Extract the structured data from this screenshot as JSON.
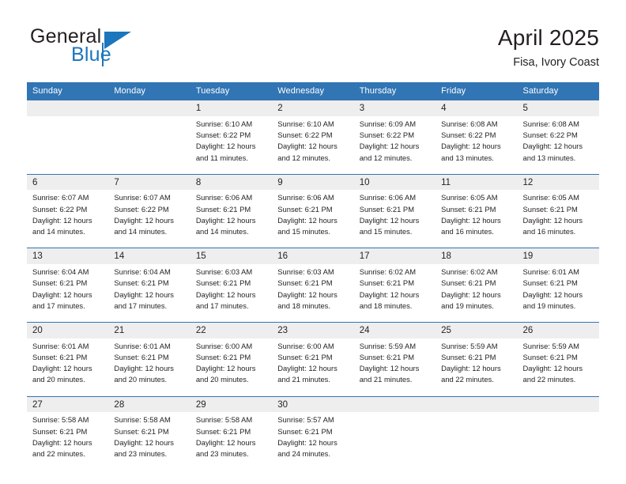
{
  "brand": {
    "name_part1": "General",
    "name_part2": "Blue",
    "logo_icon": "triangle-flag-icon"
  },
  "header": {
    "title": "April 2025",
    "subtitle": "Fisa, Ivory Coast"
  },
  "colors": {
    "header_blue": "#3175b4",
    "brand_blue": "#1c76bc",
    "daynum_band": "#eeeeee",
    "text": "#231f20"
  },
  "calendar": {
    "weekday_headers": [
      "Sunday",
      "Monday",
      "Tuesday",
      "Wednesday",
      "Thursday",
      "Friday",
      "Saturday"
    ],
    "weeks": [
      [
        {
          "day": "",
          "sunrise": "",
          "sunset": "",
          "daylight_line1": "",
          "daylight_line2": ""
        },
        {
          "day": "",
          "sunrise": "",
          "sunset": "",
          "daylight_line1": "",
          "daylight_line2": ""
        },
        {
          "day": "1",
          "sunrise": "Sunrise: 6:10 AM",
          "sunset": "Sunset: 6:22 PM",
          "daylight_line1": "Daylight: 12 hours",
          "daylight_line2": "and 11 minutes."
        },
        {
          "day": "2",
          "sunrise": "Sunrise: 6:10 AM",
          "sunset": "Sunset: 6:22 PM",
          "daylight_line1": "Daylight: 12 hours",
          "daylight_line2": "and 12 minutes."
        },
        {
          "day": "3",
          "sunrise": "Sunrise: 6:09 AM",
          "sunset": "Sunset: 6:22 PM",
          "daylight_line1": "Daylight: 12 hours",
          "daylight_line2": "and 12 minutes."
        },
        {
          "day": "4",
          "sunrise": "Sunrise: 6:08 AM",
          "sunset": "Sunset: 6:22 PM",
          "daylight_line1": "Daylight: 12 hours",
          "daylight_line2": "and 13 minutes."
        },
        {
          "day": "5",
          "sunrise": "Sunrise: 6:08 AM",
          "sunset": "Sunset: 6:22 PM",
          "daylight_line1": "Daylight: 12 hours",
          "daylight_line2": "and 13 minutes."
        }
      ],
      [
        {
          "day": "6",
          "sunrise": "Sunrise: 6:07 AM",
          "sunset": "Sunset: 6:22 PM",
          "daylight_line1": "Daylight: 12 hours",
          "daylight_line2": "and 14 minutes."
        },
        {
          "day": "7",
          "sunrise": "Sunrise: 6:07 AM",
          "sunset": "Sunset: 6:22 PM",
          "daylight_line1": "Daylight: 12 hours",
          "daylight_line2": "and 14 minutes."
        },
        {
          "day": "8",
          "sunrise": "Sunrise: 6:06 AM",
          "sunset": "Sunset: 6:21 PM",
          "daylight_line1": "Daylight: 12 hours",
          "daylight_line2": "and 14 minutes."
        },
        {
          "day": "9",
          "sunrise": "Sunrise: 6:06 AM",
          "sunset": "Sunset: 6:21 PM",
          "daylight_line1": "Daylight: 12 hours",
          "daylight_line2": "and 15 minutes."
        },
        {
          "day": "10",
          "sunrise": "Sunrise: 6:06 AM",
          "sunset": "Sunset: 6:21 PM",
          "daylight_line1": "Daylight: 12 hours",
          "daylight_line2": "and 15 minutes."
        },
        {
          "day": "11",
          "sunrise": "Sunrise: 6:05 AM",
          "sunset": "Sunset: 6:21 PM",
          "daylight_line1": "Daylight: 12 hours",
          "daylight_line2": "and 16 minutes."
        },
        {
          "day": "12",
          "sunrise": "Sunrise: 6:05 AM",
          "sunset": "Sunset: 6:21 PM",
          "daylight_line1": "Daylight: 12 hours",
          "daylight_line2": "and 16 minutes."
        }
      ],
      [
        {
          "day": "13",
          "sunrise": "Sunrise: 6:04 AM",
          "sunset": "Sunset: 6:21 PM",
          "daylight_line1": "Daylight: 12 hours",
          "daylight_line2": "and 17 minutes."
        },
        {
          "day": "14",
          "sunrise": "Sunrise: 6:04 AM",
          "sunset": "Sunset: 6:21 PM",
          "daylight_line1": "Daylight: 12 hours",
          "daylight_line2": "and 17 minutes."
        },
        {
          "day": "15",
          "sunrise": "Sunrise: 6:03 AM",
          "sunset": "Sunset: 6:21 PM",
          "daylight_line1": "Daylight: 12 hours",
          "daylight_line2": "and 17 minutes."
        },
        {
          "day": "16",
          "sunrise": "Sunrise: 6:03 AM",
          "sunset": "Sunset: 6:21 PM",
          "daylight_line1": "Daylight: 12 hours",
          "daylight_line2": "and 18 minutes."
        },
        {
          "day": "17",
          "sunrise": "Sunrise: 6:02 AM",
          "sunset": "Sunset: 6:21 PM",
          "daylight_line1": "Daylight: 12 hours",
          "daylight_line2": "and 18 minutes."
        },
        {
          "day": "18",
          "sunrise": "Sunrise: 6:02 AM",
          "sunset": "Sunset: 6:21 PM",
          "daylight_line1": "Daylight: 12 hours",
          "daylight_line2": "and 19 minutes."
        },
        {
          "day": "19",
          "sunrise": "Sunrise: 6:01 AM",
          "sunset": "Sunset: 6:21 PM",
          "daylight_line1": "Daylight: 12 hours",
          "daylight_line2": "and 19 minutes."
        }
      ],
      [
        {
          "day": "20",
          "sunrise": "Sunrise: 6:01 AM",
          "sunset": "Sunset: 6:21 PM",
          "daylight_line1": "Daylight: 12 hours",
          "daylight_line2": "and 20 minutes."
        },
        {
          "day": "21",
          "sunrise": "Sunrise: 6:01 AM",
          "sunset": "Sunset: 6:21 PM",
          "daylight_line1": "Daylight: 12 hours",
          "daylight_line2": "and 20 minutes."
        },
        {
          "day": "22",
          "sunrise": "Sunrise: 6:00 AM",
          "sunset": "Sunset: 6:21 PM",
          "daylight_line1": "Daylight: 12 hours",
          "daylight_line2": "and 20 minutes."
        },
        {
          "day": "23",
          "sunrise": "Sunrise: 6:00 AM",
          "sunset": "Sunset: 6:21 PM",
          "daylight_line1": "Daylight: 12 hours",
          "daylight_line2": "and 21 minutes."
        },
        {
          "day": "24",
          "sunrise": "Sunrise: 5:59 AM",
          "sunset": "Sunset: 6:21 PM",
          "daylight_line1": "Daylight: 12 hours",
          "daylight_line2": "and 21 minutes."
        },
        {
          "day": "25",
          "sunrise": "Sunrise: 5:59 AM",
          "sunset": "Sunset: 6:21 PM",
          "daylight_line1": "Daylight: 12 hours",
          "daylight_line2": "and 22 minutes."
        },
        {
          "day": "26",
          "sunrise": "Sunrise: 5:59 AM",
          "sunset": "Sunset: 6:21 PM",
          "daylight_line1": "Daylight: 12 hours",
          "daylight_line2": "and 22 minutes."
        }
      ],
      [
        {
          "day": "27",
          "sunrise": "Sunrise: 5:58 AM",
          "sunset": "Sunset: 6:21 PM",
          "daylight_line1": "Daylight: 12 hours",
          "daylight_line2": "and 22 minutes."
        },
        {
          "day": "28",
          "sunrise": "Sunrise: 5:58 AM",
          "sunset": "Sunset: 6:21 PM",
          "daylight_line1": "Daylight: 12 hours",
          "daylight_line2": "and 23 minutes."
        },
        {
          "day": "29",
          "sunrise": "Sunrise: 5:58 AM",
          "sunset": "Sunset: 6:21 PM",
          "daylight_line1": "Daylight: 12 hours",
          "daylight_line2": "and 23 minutes."
        },
        {
          "day": "30",
          "sunrise": "Sunrise: 5:57 AM",
          "sunset": "Sunset: 6:21 PM",
          "daylight_line1": "Daylight: 12 hours",
          "daylight_line2": "and 24 minutes."
        },
        {
          "day": "",
          "sunrise": "",
          "sunset": "",
          "daylight_line1": "",
          "daylight_line2": ""
        },
        {
          "day": "",
          "sunrise": "",
          "sunset": "",
          "daylight_line1": "",
          "daylight_line2": ""
        },
        {
          "day": "",
          "sunrise": "",
          "sunset": "",
          "daylight_line1": "",
          "daylight_line2": ""
        }
      ]
    ]
  }
}
